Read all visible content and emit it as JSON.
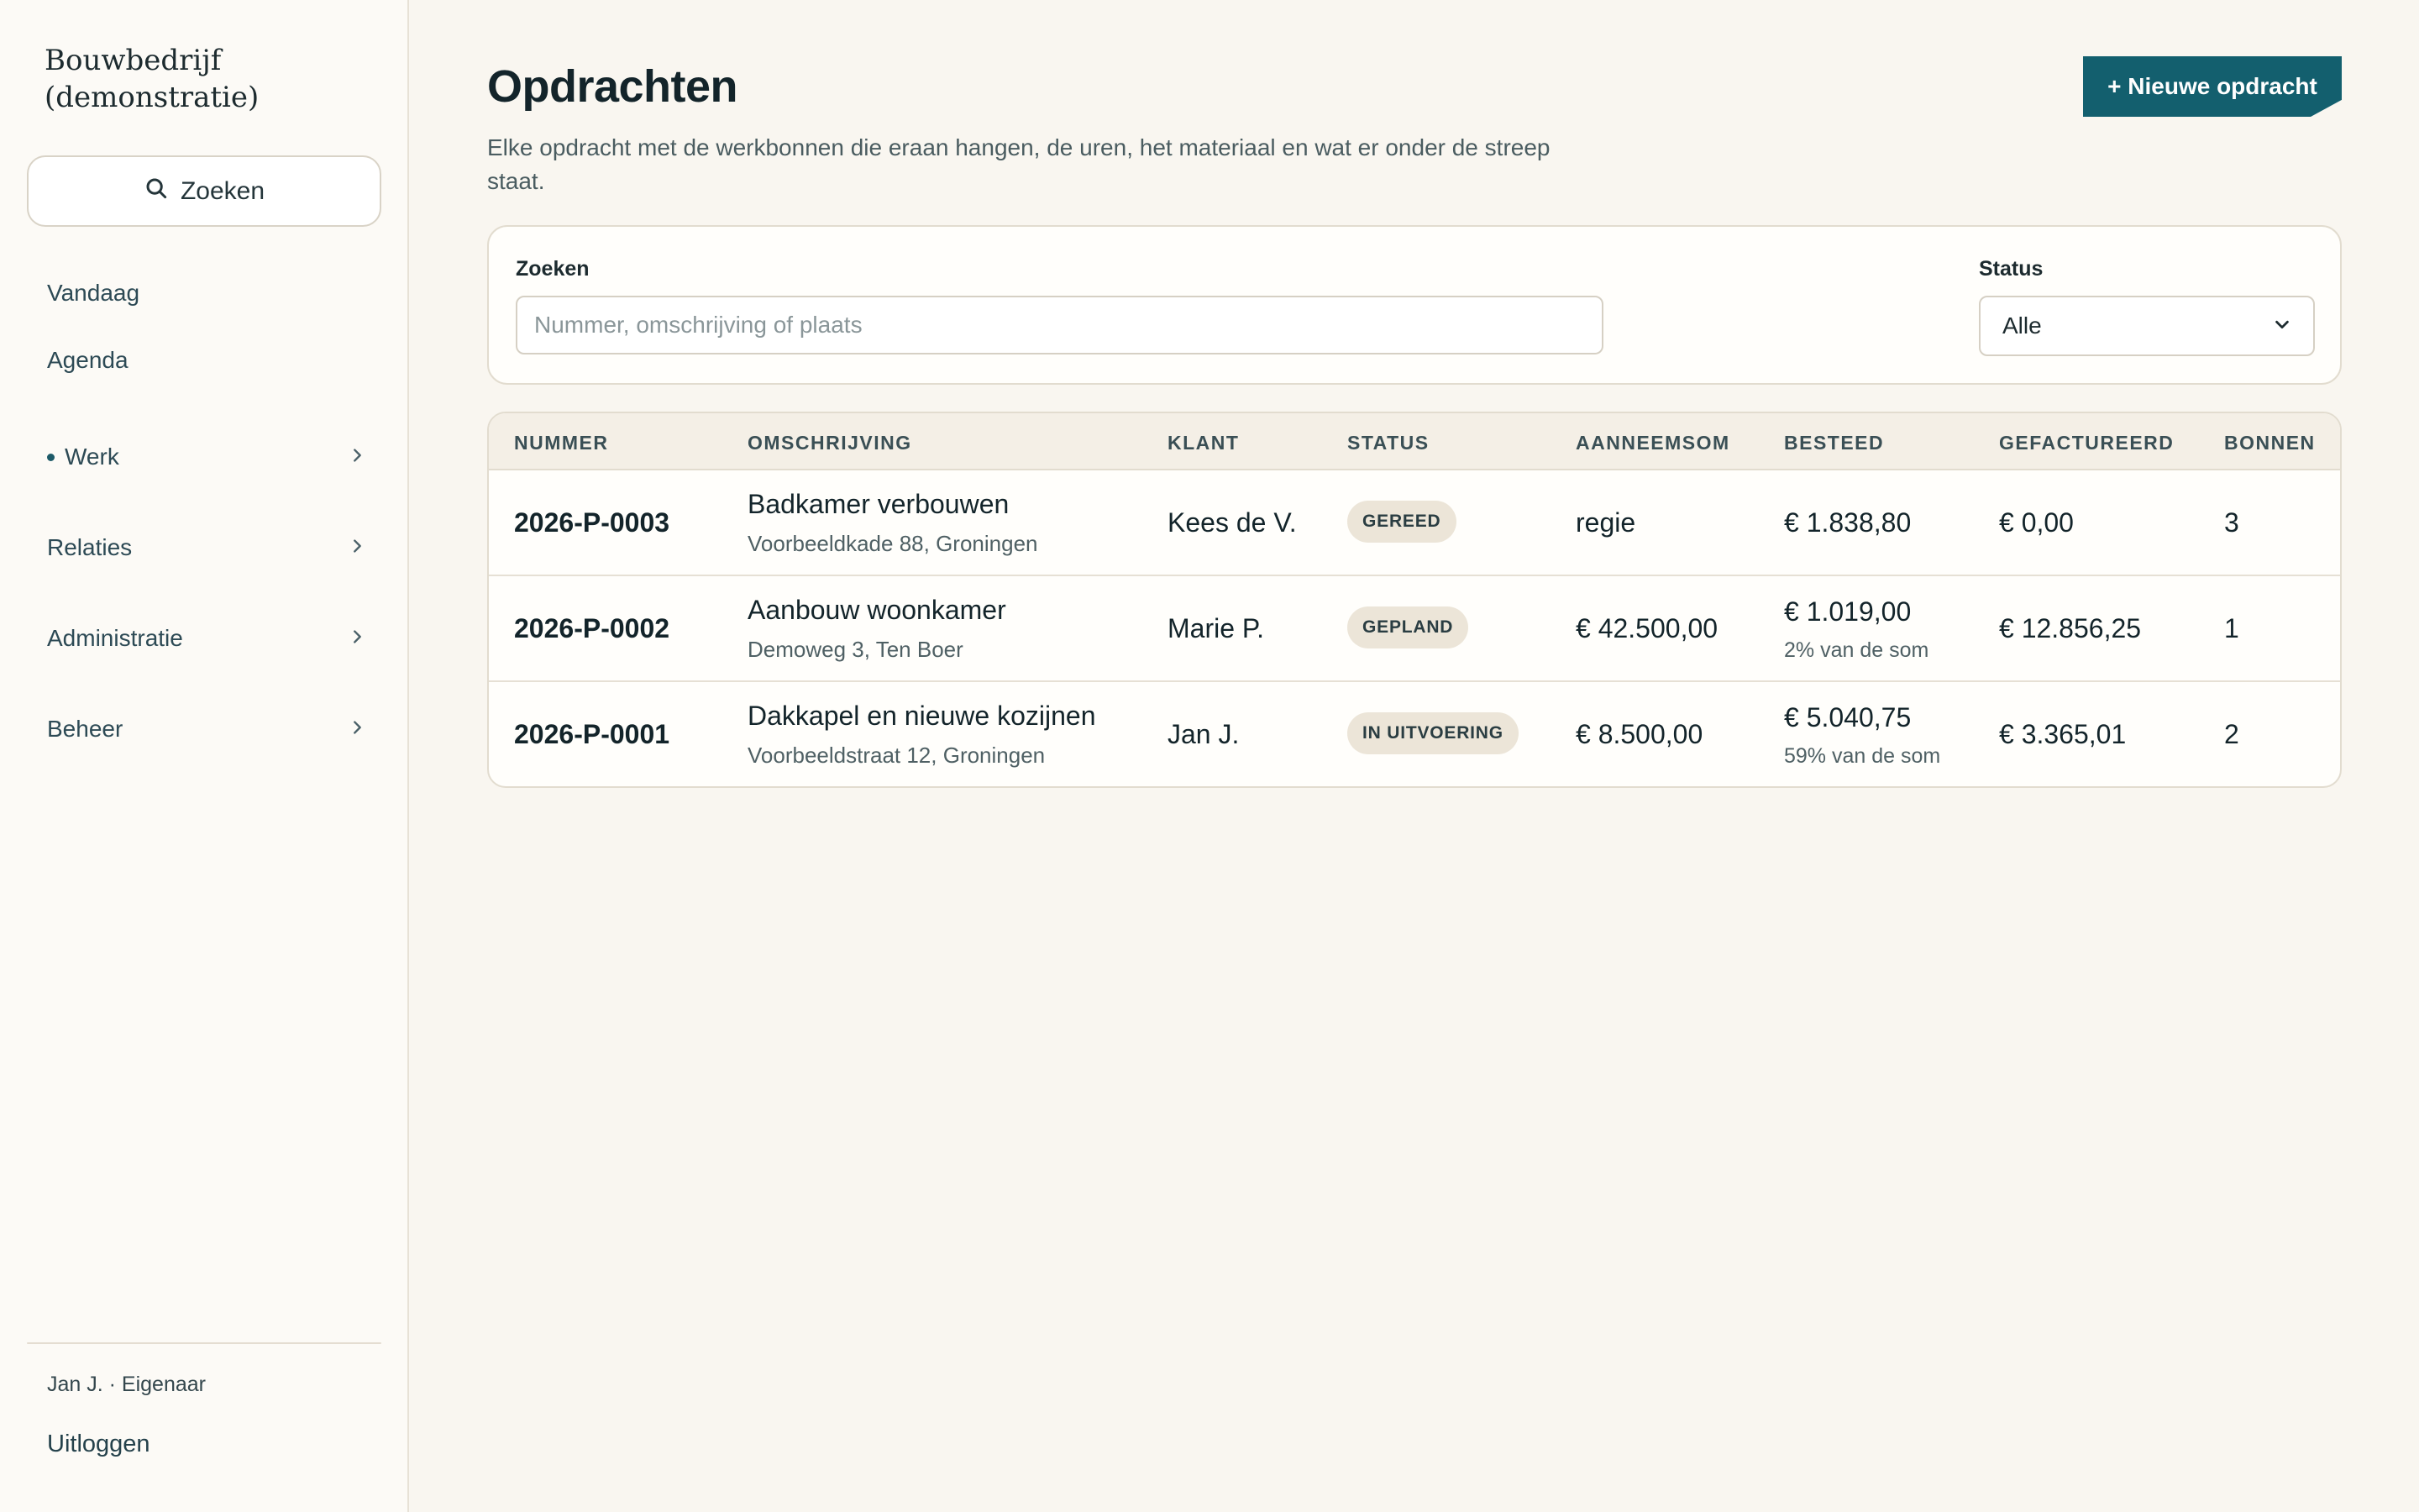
{
  "app": {
    "brand_line1": "Bouwbedrijf",
    "brand_line2": "(demonstratie)"
  },
  "sidebar": {
    "search_label": "Zoeken",
    "items": [
      {
        "label": "Vandaag",
        "expandable": false,
        "active": false
      },
      {
        "label": "Agenda",
        "expandable": false,
        "active": false
      },
      {
        "label": "Werk",
        "expandable": true,
        "active": true
      },
      {
        "label": "Relaties",
        "expandable": true,
        "active": false
      },
      {
        "label": "Administratie",
        "expandable": true,
        "active": false
      },
      {
        "label": "Beheer",
        "expandable": true,
        "active": false
      }
    ],
    "user": "Jan J. · Eigenaar",
    "logout": "Uitloggen"
  },
  "header": {
    "title": "Opdrachten",
    "description": "Elke opdracht met de werkbonnen die eraan hangen, de uren, het materiaal en wat er onder de streep staat.",
    "new_button": "+ Nieuwe opdracht"
  },
  "filters": {
    "search_label": "Zoeken",
    "search_placeholder": "Nummer, omschrijving of plaats",
    "search_value": "",
    "status_label": "Status",
    "status_value": "Alle"
  },
  "table": {
    "columns": [
      "NUMMER",
      "OMSCHRIJVING",
      "KLANT",
      "STATUS",
      "AANNEEMSOM",
      "BESTEED",
      "GEFACTUREERD",
      "BONNEN"
    ],
    "rows": [
      {
        "number": "2026-P-0003",
        "description": "Badkamer verbouwen",
        "address": "Voorbeeldkade 88, Groningen",
        "client": "Kees de V.",
        "status": "GEREED",
        "sum": "regie",
        "spent": "€ 1.838,80",
        "spent_sub": "",
        "invoiced": "€ 0,00",
        "bonnen": "3"
      },
      {
        "number": "2026-P-0002",
        "description": "Aanbouw woonkamer",
        "address": "Demoweg 3, Ten Boer",
        "client": "Marie P.",
        "status": "GEPLAND",
        "sum": "€ 42.500,00",
        "spent": "€ 1.019,00",
        "spent_sub": "2% van de som",
        "invoiced": "€ 12.856,25",
        "bonnen": "1"
      },
      {
        "number": "2026-P-0001",
        "description": "Dakkapel en nieuwe kozijnen",
        "address": "Voorbeeldstraat 12, Groningen",
        "client": "Jan J.",
        "status": "IN UITVOERING",
        "sum": "€ 8.500,00",
        "spent": "€ 5.040,75",
        "spent_sub": "59% van de som",
        "invoiced": "€ 3.365,01",
        "bonnen": "2"
      }
    ]
  },
  "colors": {
    "accent": "#135f6e",
    "background": "#f9f6f0",
    "badge": "#ece5d8"
  }
}
